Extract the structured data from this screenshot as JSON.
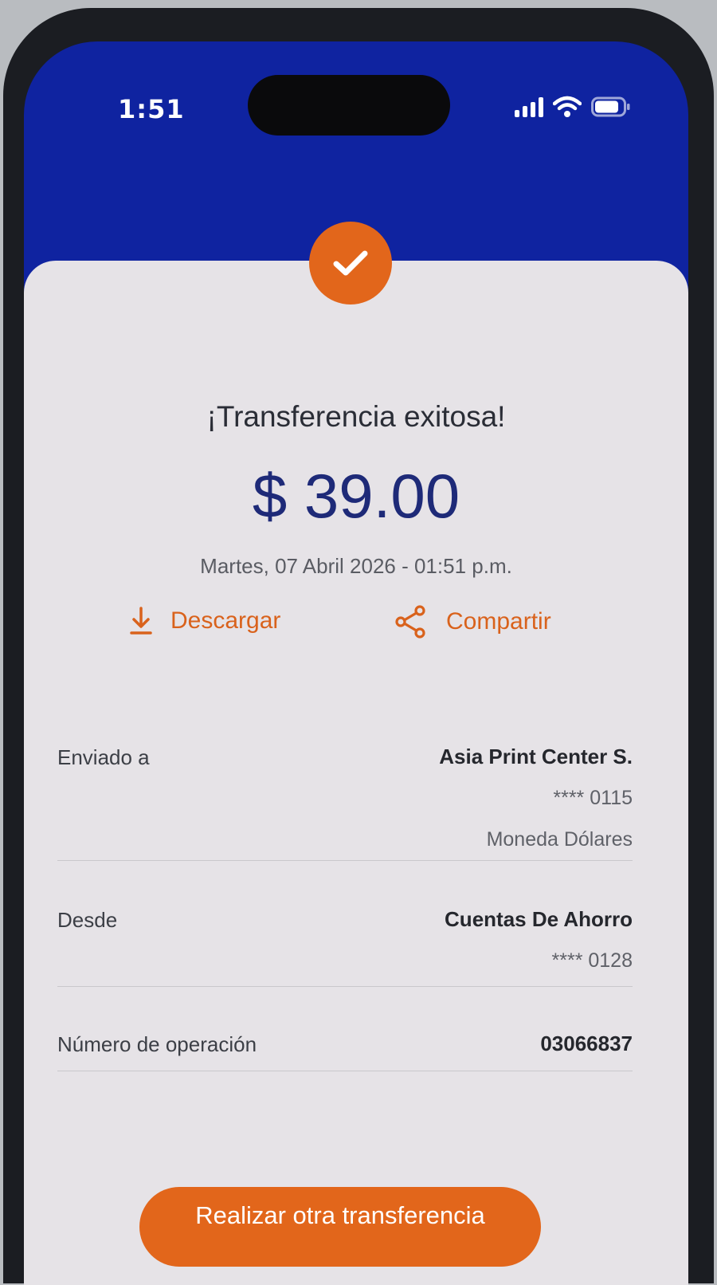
{
  "status_bar": {
    "time": "1:51"
  },
  "receipt": {
    "title": "¡Transferencia exitosa!",
    "amount": "$ 39.00",
    "datetime": "Martes, 07 Abril 2026 - 01:51 p.m.",
    "actions": {
      "download_label": "Descargar",
      "share_label": "Compartir"
    },
    "details": {
      "sent_to": {
        "label": "Enviado a",
        "name": "Asia Print Center S.",
        "account": "**** 0115",
        "currency": "Moneda Dólares"
      },
      "from": {
        "label": "Desde",
        "account_type": "Cuentas De Ahorro",
        "account": "**** 0128"
      },
      "operation": {
        "label": "Número de operación",
        "number": "03066837"
      }
    },
    "primary_button": "Realizar otra transferencia"
  },
  "icons": {
    "success": "check-icon",
    "download": "download-icon",
    "share": "share-icon",
    "signal": "cellular-signal-icon",
    "wifi": "wifi-icon",
    "battery": "battery-icon"
  },
  "colors": {
    "header_blue": "#0f23a0",
    "accent_orange": "#e2661b",
    "amount_navy": "#1e2a78",
    "card_background": "#e6e3e7"
  }
}
